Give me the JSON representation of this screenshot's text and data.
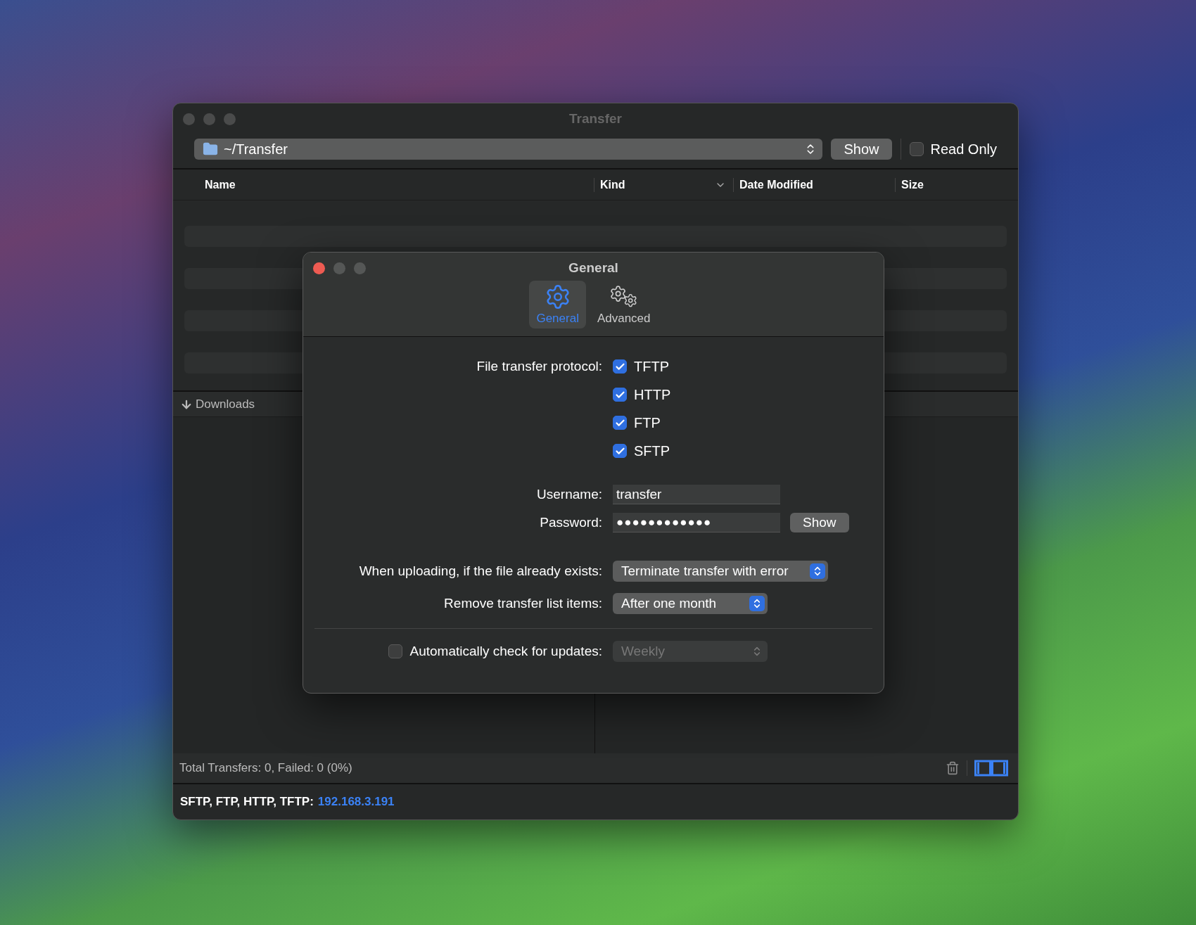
{
  "main_window": {
    "title": "Transfer",
    "folder_path": "~/Transfer",
    "show_button": "Show",
    "read_only": {
      "label": "Read Only",
      "checked": false
    },
    "columns": [
      {
        "label": "Name",
        "sorted": false
      },
      {
        "label": "Kind",
        "sorted": true
      },
      {
        "label": "Date Modified",
        "sorted": false
      },
      {
        "label": "Size",
        "sorted": false
      }
    ],
    "section": "Downloads",
    "status": "Total Transfers: 0, Failed: 0 (0%)",
    "footer": {
      "label": "SFTP, FTP, HTTP, TFTP:",
      "address": "192.168.3.191"
    }
  },
  "dialog": {
    "title": "General",
    "tabs": [
      {
        "label": "General",
        "selected": true
      },
      {
        "label": "Advanced",
        "selected": false
      }
    ],
    "protocol_label": "File transfer protocol:",
    "protocols": [
      {
        "label": "TFTP",
        "checked": true
      },
      {
        "label": "HTTP",
        "checked": true
      },
      {
        "label": "FTP",
        "checked": true
      },
      {
        "label": "SFTP",
        "checked": true
      }
    ],
    "username": {
      "label": "Username:",
      "value": "transfer"
    },
    "password": {
      "label": "Password:",
      "value": "●●●●●●●●●●●●",
      "button": "Show"
    },
    "selects": [
      {
        "label": "When uploading, if the file already exists:",
        "value": "Terminate transfer with error"
      },
      {
        "label": "Remove transfer list items:",
        "value": "After one month"
      }
    ],
    "auto_update": {
      "label": "Automatically check for updates:",
      "checked": false,
      "value": "Weekly",
      "disabled": true
    }
  }
}
